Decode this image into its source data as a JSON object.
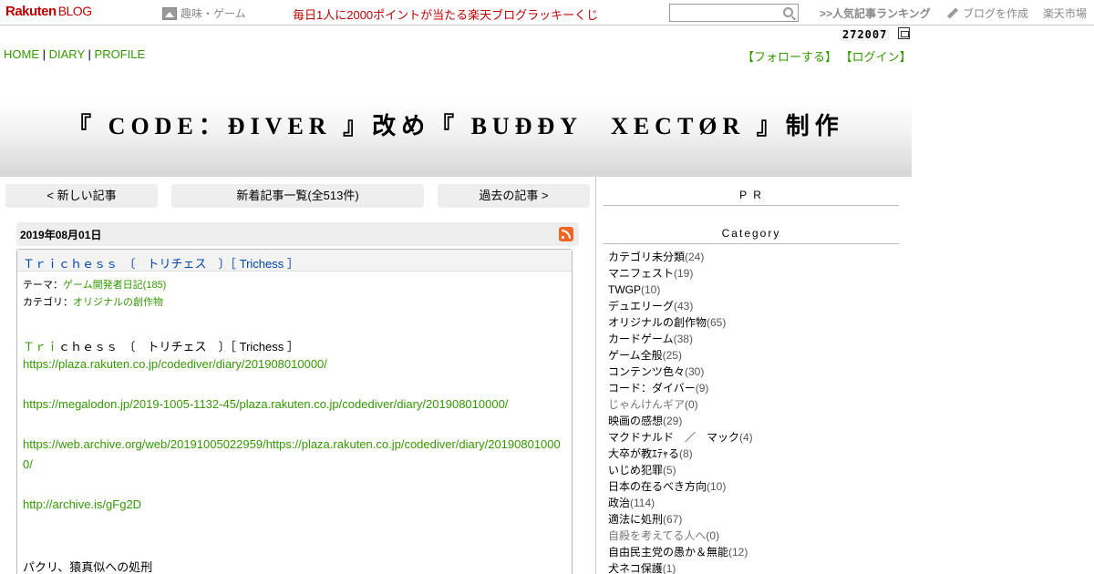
{
  "topbar": {
    "logo": "Rakuten",
    "logo_sub": "BLOG",
    "hobby_label": "趣味・ゲーム",
    "lucky_text": "毎日1人に2000ポイントが当たる楽天ブログラッキーくじ",
    "search_placeholder": "",
    "ranking_label": ">>人気記事ランキング",
    "create_label": "ブログを作成",
    "market_label": "楽天市場"
  },
  "counter": "272007",
  "nav": {
    "home": "HOME",
    "diary": "DIARY",
    "profile": "PROFILE",
    "sep": "|",
    "follow": "【フォローする】",
    "login": "【ログイン】"
  },
  "banner": {
    "title": "『 CODE：ĐIVER 』改め『 BUĐĐY　XECTØR 』制作"
  },
  "pager": {
    "newer": "< 新しい記事",
    "list": "新着記事一覧(全513件)",
    "older": "過去の記事 >"
  },
  "article": {
    "date": "2019年08月01日",
    "title": "Ｔｒｉｃｈｅｓｓ　〔　トリチェス　〕［ Trichess ］",
    "theme_label": "テーマ：",
    "theme_value": "ゲーム開発者日記(185)",
    "category_label": "カテゴリ：",
    "category_value": "オリジナルの創作物",
    "body_title_green": "Ｔｒｉ",
    "body_title_rest": "ｃｈｅｓｓ　〔　トリチェス　〕［ Trichess ］",
    "link1": "https://plaza.rakuten.co.jp/codediver/diary/201908010000/",
    "link2": "https://megalodon.jp/2019-1005-1132-45/plaza.rakuten.co.jp/codediver/diary/201908010000/",
    "link3a": "https://web.archive.org/web/20191005022959/https://plaza.rakuten.co.jp/codediver/diary/20190801000",
    "link3b": "0/",
    "link4": "http://archive.is/gFg2D",
    "last_line": "パクリ、猿真似への処刑"
  },
  "sidebar": {
    "pr": "P R",
    "category": "Category",
    "categories": [
      {
        "name": "カテゴリ未分類",
        "count": "(24)"
      },
      {
        "name": "マニフェスト",
        "count": "(19)"
      },
      {
        "name": "TWGP",
        "count": "(10)"
      },
      {
        "name": "デュエリーグ",
        "count": "(43)"
      },
      {
        "name": "オリジナルの創作物",
        "count": "(65)"
      },
      {
        "name": "カードゲーム",
        "count": "(38)"
      },
      {
        "name": "ゲーム全般",
        "count": "(25)"
      },
      {
        "name": "コンテンツ色々",
        "count": "(30)"
      },
      {
        "name": "コード：ダイバー",
        "count": "(9)"
      },
      {
        "name": "じゃんけんギア",
        "count": "(0)"
      },
      {
        "name": "映画の感想",
        "count": "(29)"
      },
      {
        "name": "マクドナルド　／　マック",
        "count": "(4)"
      },
      {
        "name": "大卒が教ｴﾃｬる",
        "count": "(8)"
      },
      {
        "name": "いじめ犯罪",
        "count": "(5)"
      },
      {
        "name": "日本の在るべき方向",
        "count": "(10)"
      },
      {
        "name": "政治",
        "count": "(114)"
      },
      {
        "name": "適法に処刑",
        "count": "(67)"
      },
      {
        "name": "自殺を考えてる人へ",
        "count": "(0)"
      },
      {
        "name": "自由民主党の愚か＆無能",
        "count": "(12)"
      },
      {
        "name": "犬ネコ保護",
        "count": "(1)"
      }
    ]
  }
}
